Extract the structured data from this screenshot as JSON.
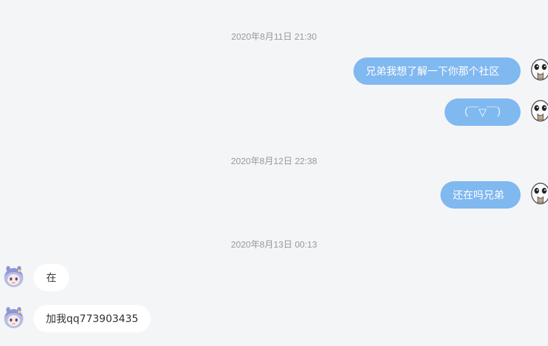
{
  "messages": [
    {
      "time": "2020年8月11日 21:30"
    },
    {
      "side": "right",
      "text": "兄弟我想了解一下你那个社区",
      "avatar": "white-sticker-avatar"
    },
    {
      "side": "right",
      "text": "（￣▽￣）",
      "avatar": "white-sticker-avatar"
    },
    {
      "time": "2020年8月12日 22:38"
    },
    {
      "side": "right",
      "text": "还在吗兄弟",
      "avatar": "white-sticker-avatar"
    },
    {
      "time": "2020年8月13日 00:13"
    },
    {
      "side": "left",
      "text": "在",
      "avatar": "anime-girl-avatar"
    },
    {
      "side": "left",
      "text": "加我qq773903435",
      "avatar": "anime-girl-avatar"
    }
  ],
  "colors": {
    "background": "#f4f5f7",
    "outgoing_bubble": "#80b8f0",
    "incoming_bubble": "#ffffff",
    "timestamp_text": "#999999"
  }
}
